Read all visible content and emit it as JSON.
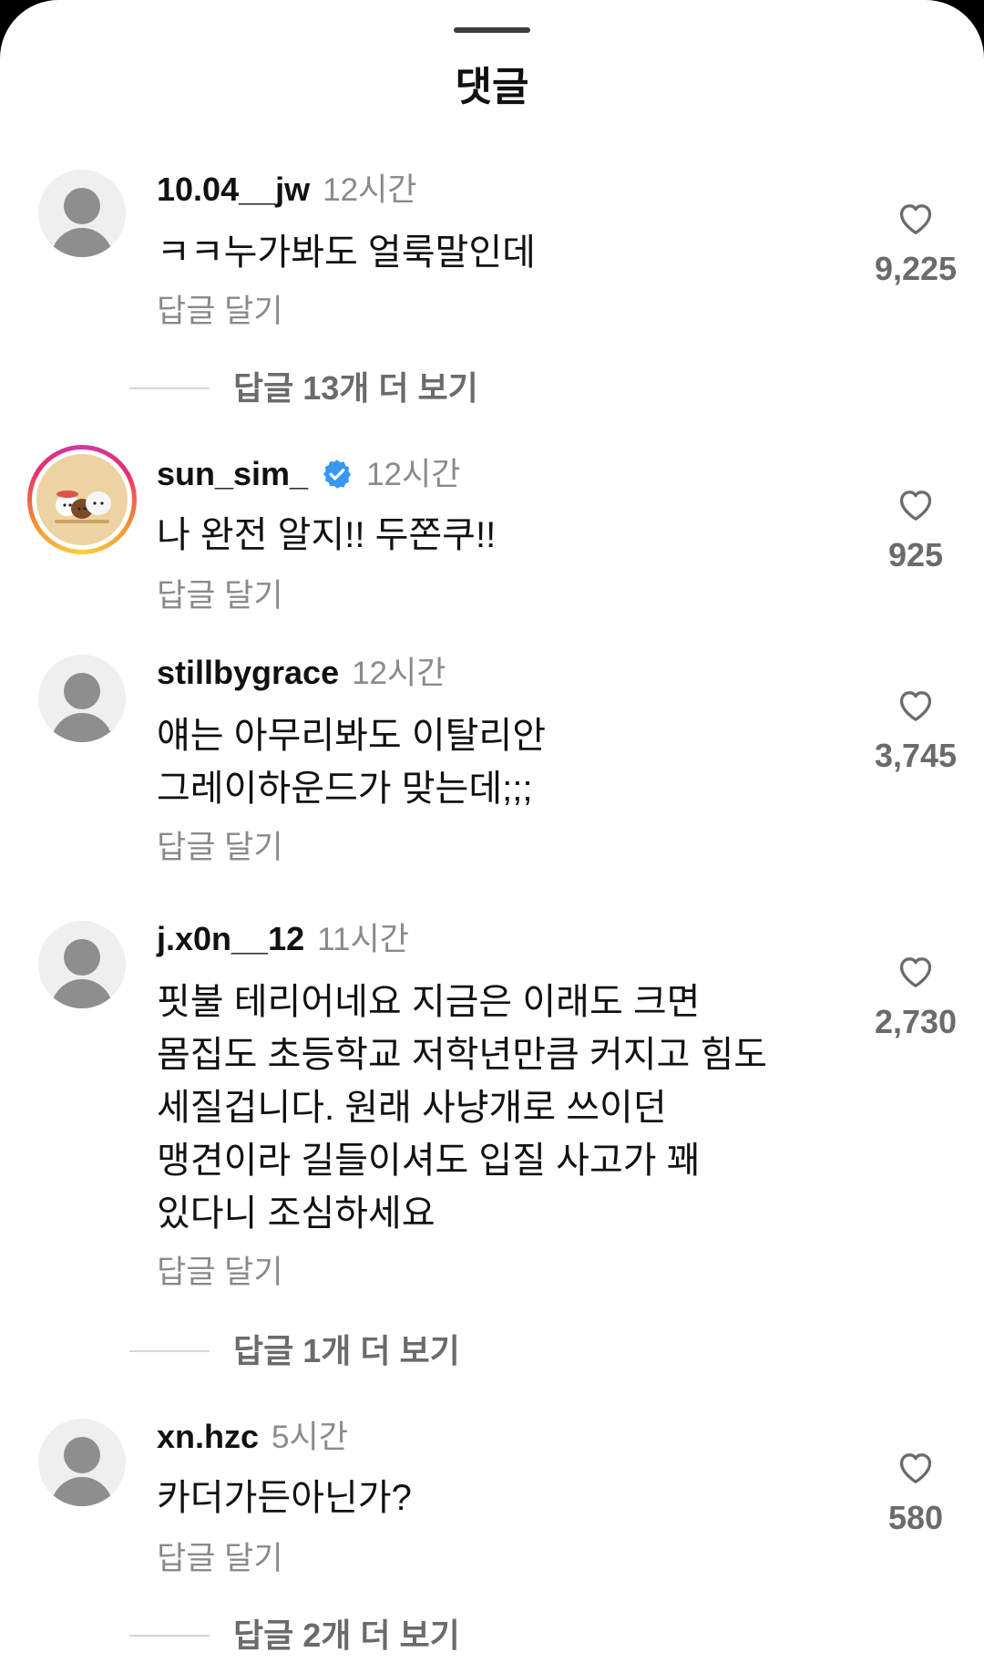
{
  "header": {
    "title": "댓글"
  },
  "comments": [
    {
      "username": "10.04__jw",
      "time": "12시간",
      "text": "ㅋㅋ누가봐도 얼룩말인데",
      "reply_label": "답글 달기",
      "likes": "9,225",
      "avatar": "default-avatar",
      "more_replies": "답글 13개 더 보기"
    },
    {
      "username": "sun_sim_",
      "verified": true,
      "time": "12시간",
      "text": "나 완전 알지!! 두쫀쿠!!",
      "reply_label": "답글 달기",
      "likes": "925",
      "avatar": "story-ring-photo"
    },
    {
      "username": "stillbygrace",
      "time": "12시간",
      "text": "얘는 아무리봐도 이탈리안\n그레이하운드가 맞는데;;;",
      "reply_label": "답글 달기",
      "likes": "3,745",
      "avatar": "default-avatar"
    },
    {
      "username": "j.x0n__12",
      "time": "11시간",
      "text": "핏불 테리어네요 지금은 이래도 크면\n몸집도 초등학교 저학년만큼 커지고 힘도\n세질겁니다. 원래 사냥개로 쓰이던\n맹견이라 길들이셔도 입질 사고가 꽤\n있다니 조심하세요",
      "reply_label": "답글 달기",
      "likes": "2,730",
      "avatar": "default-avatar",
      "more_replies": "답글 1개 더 보기"
    },
    {
      "username": "xn.hzc",
      "time": "5시간",
      "text": "카더가든아닌가?",
      "reply_label": "답글 달기",
      "likes": "580",
      "avatar": "default-avatar",
      "more_replies": "답글 2개 더 보기"
    }
  ],
  "colors": {
    "text_primary": "#111111",
    "text_secondary": "#8a8a8a",
    "verified_blue": "#3897f0"
  },
  "icons": [
    "heart-outline-icon",
    "verified-badge-icon",
    "default-avatar-icon"
  ]
}
